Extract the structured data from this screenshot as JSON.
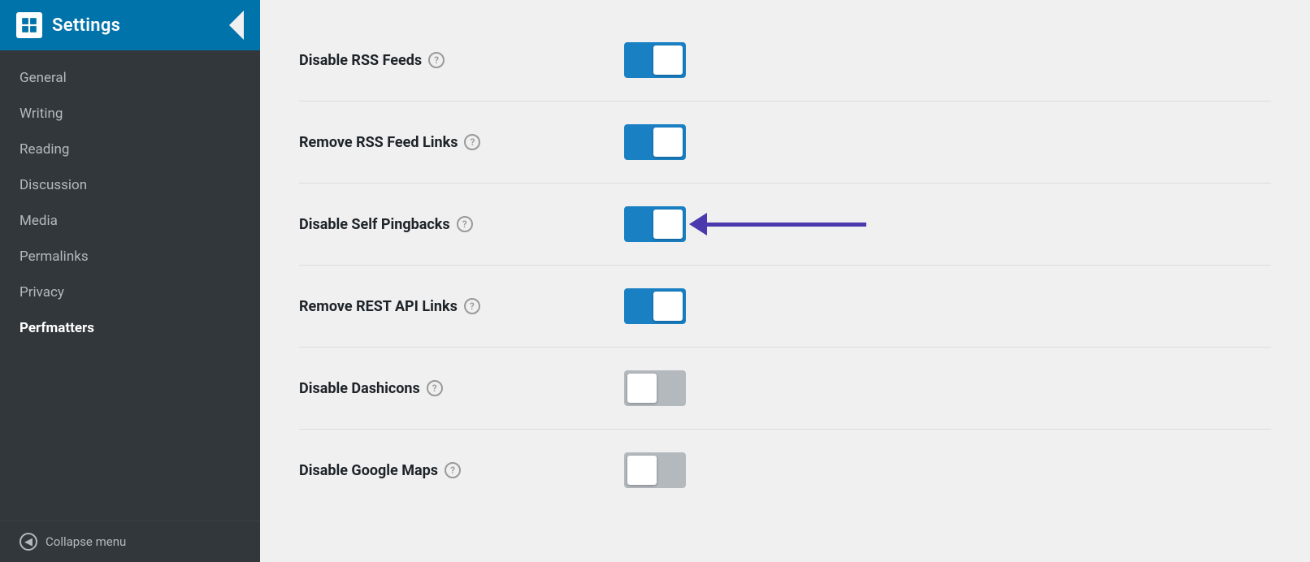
{
  "sidebar": {
    "header": {
      "title": "Settings",
      "logo_alt": "WordPress logo"
    },
    "nav_items": [
      {
        "label": "General",
        "active": false
      },
      {
        "label": "Writing",
        "active": false
      },
      {
        "label": "Reading",
        "active": false
      },
      {
        "label": "Discussion",
        "active": false
      },
      {
        "label": "Media",
        "active": false
      },
      {
        "label": "Permalinks",
        "active": false
      },
      {
        "label": "Privacy",
        "active": false
      },
      {
        "label": "Perfmatters",
        "active": true
      }
    ],
    "collapse_label": "Collapse menu"
  },
  "settings": {
    "rows": [
      {
        "label": "Disable RSS Feeds",
        "state": "on",
        "annotated": false
      },
      {
        "label": "Remove RSS Feed Links",
        "state": "on",
        "annotated": false
      },
      {
        "label": "Disable Self Pingbacks",
        "state": "on",
        "annotated": true
      },
      {
        "label": "Remove REST API Links",
        "state": "on",
        "annotated": false
      },
      {
        "label": "Disable Dashicons",
        "state": "off",
        "annotated": false
      },
      {
        "label": "Disable Google Maps",
        "state": "off",
        "annotated": false
      }
    ]
  },
  "icons": {
    "help": "?",
    "collapse": "◀"
  }
}
